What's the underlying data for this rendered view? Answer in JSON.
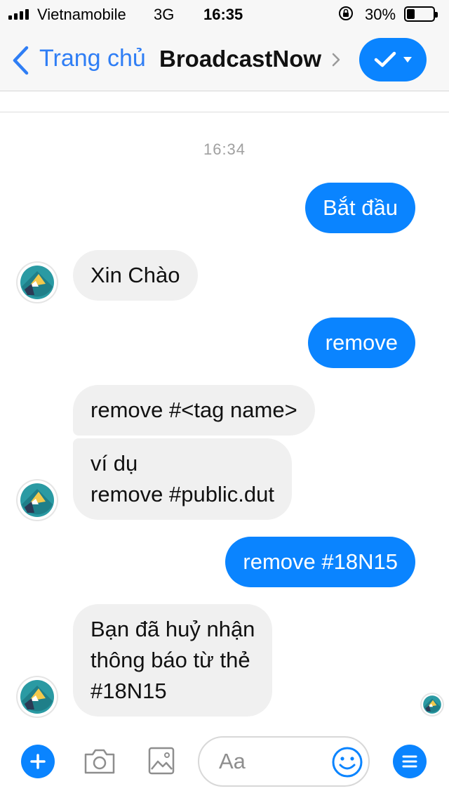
{
  "status_bar": {
    "carrier": "Vietnamobile",
    "network": "3G",
    "time": "16:35",
    "battery": "30%",
    "battery_level": 0.3
  },
  "nav": {
    "back_label": "Trang chủ",
    "title": "BroadcastNow",
    "accent": "#0a84ff"
  },
  "chat": {
    "timestamp": "16:34",
    "messages": [
      {
        "from": "me",
        "lines": [
          "Bắt đầu"
        ]
      },
      {
        "from": "bot",
        "lines": [
          "Xin Chào"
        ]
      },
      {
        "from": "me",
        "lines": [
          "remove"
        ]
      },
      {
        "from": "bot",
        "lines": [
          "remove #<tag name>"
        ]
      },
      {
        "from": "bot",
        "lines": [
          "ví dụ",
          "remove #public.dut"
        ]
      },
      {
        "from": "me",
        "lines": [
          "remove #18N15"
        ]
      },
      {
        "from": "bot",
        "lines": [
          "Bạn đã huỷ nhận",
          "thông báo từ thẻ",
          "#18N15"
        ]
      }
    ]
  },
  "composer": {
    "placeholder": "Aa"
  },
  "icons": {
    "add": "plus-icon",
    "camera": "camera-icon",
    "gallery": "image-icon",
    "emoji": "smiley-icon",
    "menu": "menu-icon"
  }
}
